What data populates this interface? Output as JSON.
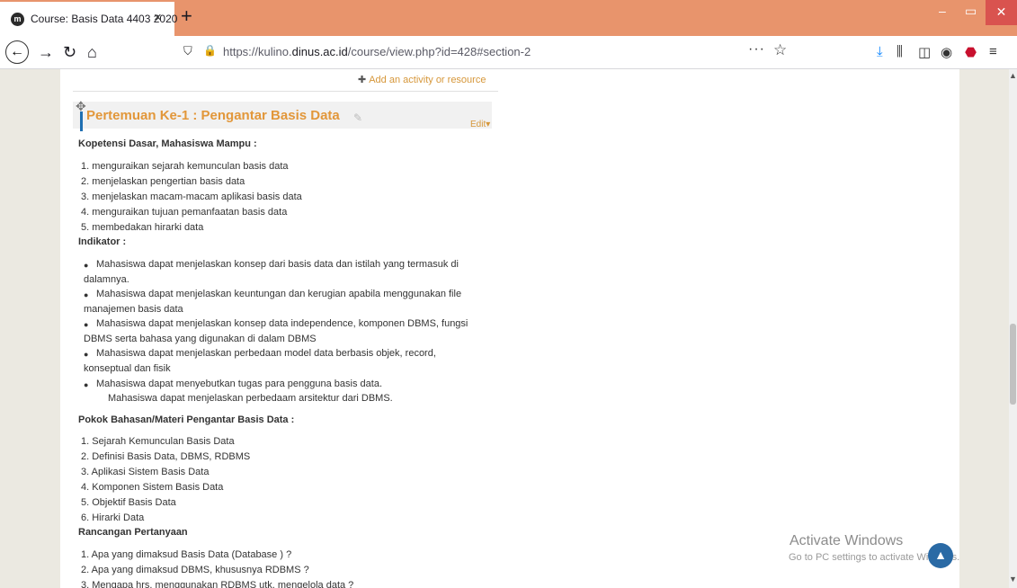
{
  "browser": {
    "tab_title": "Course: Basis Data 4403 2020",
    "tab_favicon_letter": "m",
    "tab_close": "×",
    "new_tab": "+",
    "url_prefix": "https://kulino.",
    "url_domain": "dinus.ac.id",
    "url_path": "/course/view.php?id=428#section-2",
    "icons": [
      "back-icon",
      "forward-icon",
      "reload-icon",
      "home-icon",
      "shield-icon",
      "lock-icon",
      "more-icon",
      "star-icon",
      "download-icon",
      "library-icon",
      "sidebar-icon",
      "account-icon",
      "adblock-icon",
      "menu-icon"
    ]
  },
  "section": {
    "add_activity": "Add an activity or resource",
    "title": "Pertemuan Ke-1 : Pengantar Basis Data",
    "edit": "Edit"
  },
  "kompetensi": {
    "heading": "Kopetensi Dasar, Mahasiswa Mampu :",
    "items": [
      "1. menguraikan sejarah kemunculan basis data",
      "2. menjelaskan pengertian basis data",
      "3. menjelaskan macam-macam aplikasi basis data",
      "4. menguraikan tujuan pemanfaatan basis data",
      "5. membedakan hirarki data"
    ]
  },
  "indikator": {
    "heading": "Indikator :",
    "lines": [
      "Mahasiswa dapat menjelaskan konsep dari basis data dan istilah yang termasuk di",
      "dalamnya.",
      "Mahasiswa dapat menjelaskan keuntungan dan  kerugian apabila menggunakan file",
      "manajemen basis data",
      "Mahasiswa dapat menjelaskan konsep data independence, komponen DBMS, fungsi",
      "DBMS serta bahasa yang digunakan di dalam DBMS",
      "Mahasiswa dapat menjelaskan perbedaan model data berbasis objek, record,",
      "konseptual dan fisik",
      "Mahasiswa dapat menyebutkan tugas para pengguna basis data.",
      "Mahasiswa dapat menjelaskan perbedaam arsitektur dari DBMS."
    ]
  },
  "pokok": {
    "heading": "Pokok Bahasan/Materi Pengantar Basis Data :",
    "items": [
      "1. Sejarah Kemunculan Basis Data",
      "2. Definisi Basis Data, DBMS, RDBMS",
      "3. Aplikasi Sistem Basis Data",
      "4. Komponen Sistem Basis Data",
      "5. Objektif Basis Data",
      "6. Hirarki Data"
    ]
  },
  "rancangan": {
    "heading": "Rancangan  Pertanyaan",
    "items": [
      "1. Apa yang dimaksud Basis Data (Database ) ?",
      "2. Apa yang dimaksud DBMS, khususnya RDBMS ?",
      "3. Mengapa hrs. menggunakan RDBMS utk. mengelola data ?"
    ]
  },
  "watermark": {
    "title": "Activate Windows",
    "subtitle": "Go to PC settings to activate Windows."
  }
}
